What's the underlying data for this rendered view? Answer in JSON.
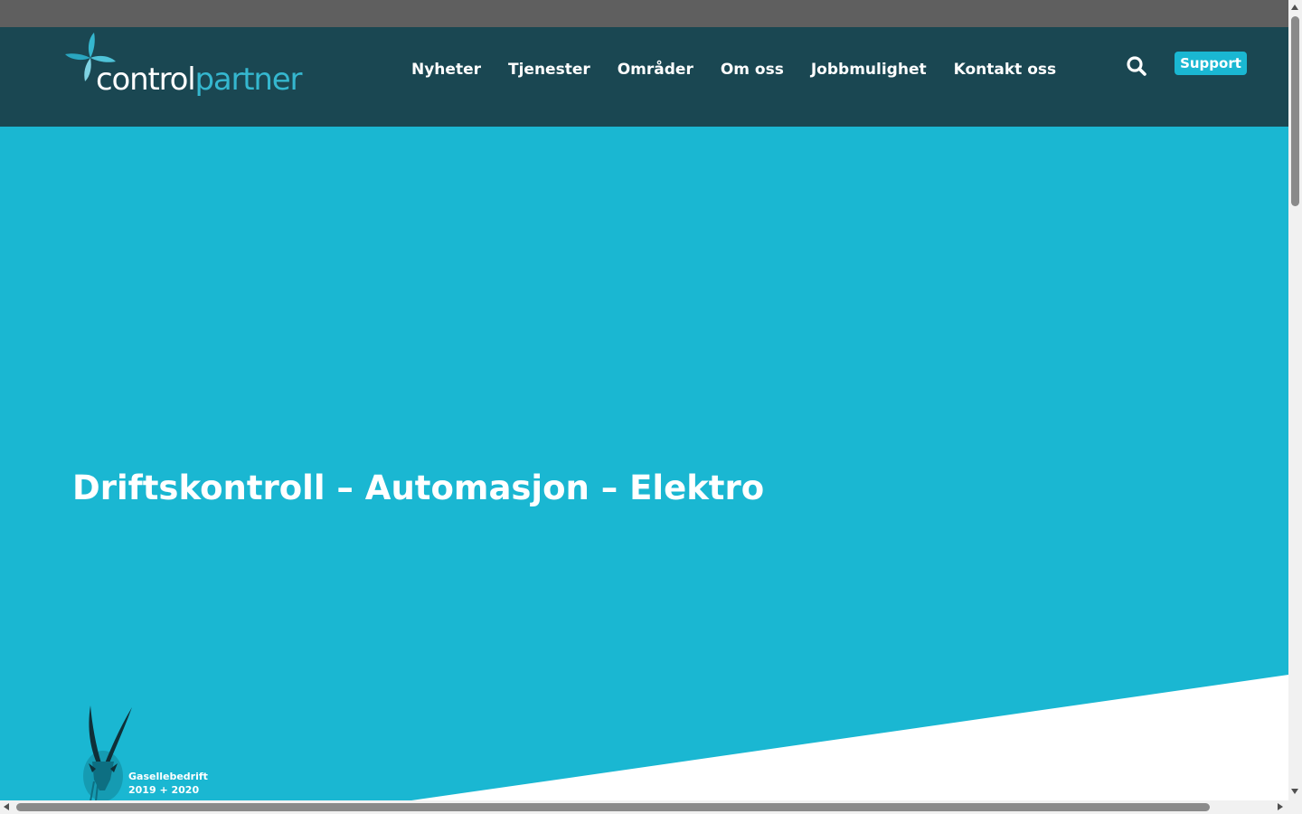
{
  "header": {
    "logo": {
      "text_part1": "control",
      "text_part2": "partner",
      "icon": "flower-logo-icon"
    },
    "nav": [
      {
        "label": "Nyheter"
      },
      {
        "label": "Tjenester"
      },
      {
        "label": "Områder"
      },
      {
        "label": "Om oss"
      },
      {
        "label": "Jobbmulighet"
      },
      {
        "label": "Kontakt oss"
      }
    ],
    "search_icon": "search-icon",
    "support_label": "Support"
  },
  "hero": {
    "title": "Driftskontroll – Automasjon – Elektro"
  },
  "badge": {
    "icon": "gazelle-icon",
    "line1": "Gasellebedrift",
    "line2": "2019 + 2020"
  },
  "colors": {
    "top_strip": "#5f5f5f",
    "header_bg": "#1a4752",
    "accent": "#1ab7d2",
    "logo_accent": "#35b7cf",
    "text": "#ffffff"
  }
}
